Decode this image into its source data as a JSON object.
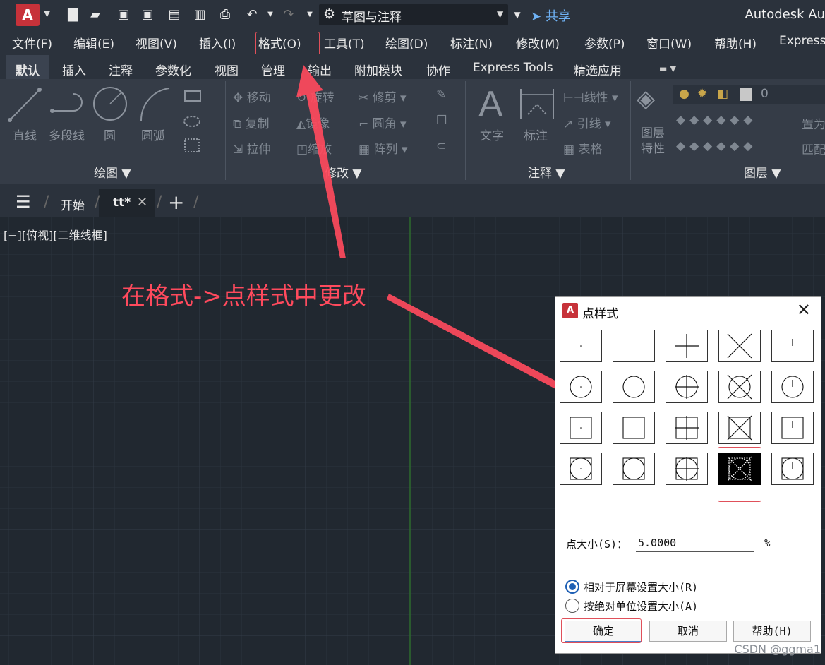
{
  "app": {
    "logo": "A",
    "title": "Autodesk Au",
    "workspace": "草图与注释",
    "share": "共享"
  },
  "menubar": [
    "文件(F)",
    "编辑(E)",
    "视图(V)",
    "插入(I)",
    "格式(O)",
    "工具(T)",
    "绘图(D)",
    "标注(N)",
    "修改(M)",
    "参数(P)",
    "窗口(W)",
    "帮助(H)",
    "Express"
  ],
  "ribbon_tabs": [
    "默认",
    "插入",
    "注释",
    "参数化",
    "视图",
    "管理",
    "输出",
    "附加模块",
    "协作",
    "Express Tools",
    "精选应用"
  ],
  "ribbon": {
    "draw": {
      "title": "绘图",
      "line": "直线",
      "polyline": "多段线",
      "circle": "圆",
      "arc": "圆弧"
    },
    "modify": {
      "title": "修改",
      "move": "移动",
      "rotate": "旋转",
      "trim": "修剪",
      "copy": "复制",
      "mirror": "镜像",
      "fillet": "圆角",
      "stretch": "拉伸",
      "scale": "缩放",
      "array": "阵列"
    },
    "annotation": {
      "title": "注释",
      "text": "文字",
      "dimension": "标注",
      "linear": "线性",
      "leader": "引线",
      "table": "表格"
    },
    "layers": {
      "title": "图层",
      "properties": "图层\n特性",
      "layer_name": "0",
      "match": "匹配",
      "set_current": "置为"
    }
  },
  "file_tabs": {
    "start": "开始",
    "current": "tt*"
  },
  "viewport": {
    "label": "[−][俯视][二维线框]"
  },
  "annotation": "在格式->点样式中更改",
  "dialog": {
    "title": "点样式",
    "icon_label": "A",
    "size_label": "点大小(S)：",
    "size_value": "5.0000",
    "size_unit": "%",
    "radio_relative": "相对于屏幕设置大小(R)",
    "radio_absolute": "按绝对单位设置大小(A)",
    "ok": "确定",
    "cancel": "取消",
    "help": "帮助(H)",
    "selected_style_index": 18
  },
  "watermark": "CSDN @ggma1",
  "colors": {
    "annotation": "#ff4a5d",
    "highlight_box": "#e0505a",
    "accent": "#1e5fb4"
  }
}
